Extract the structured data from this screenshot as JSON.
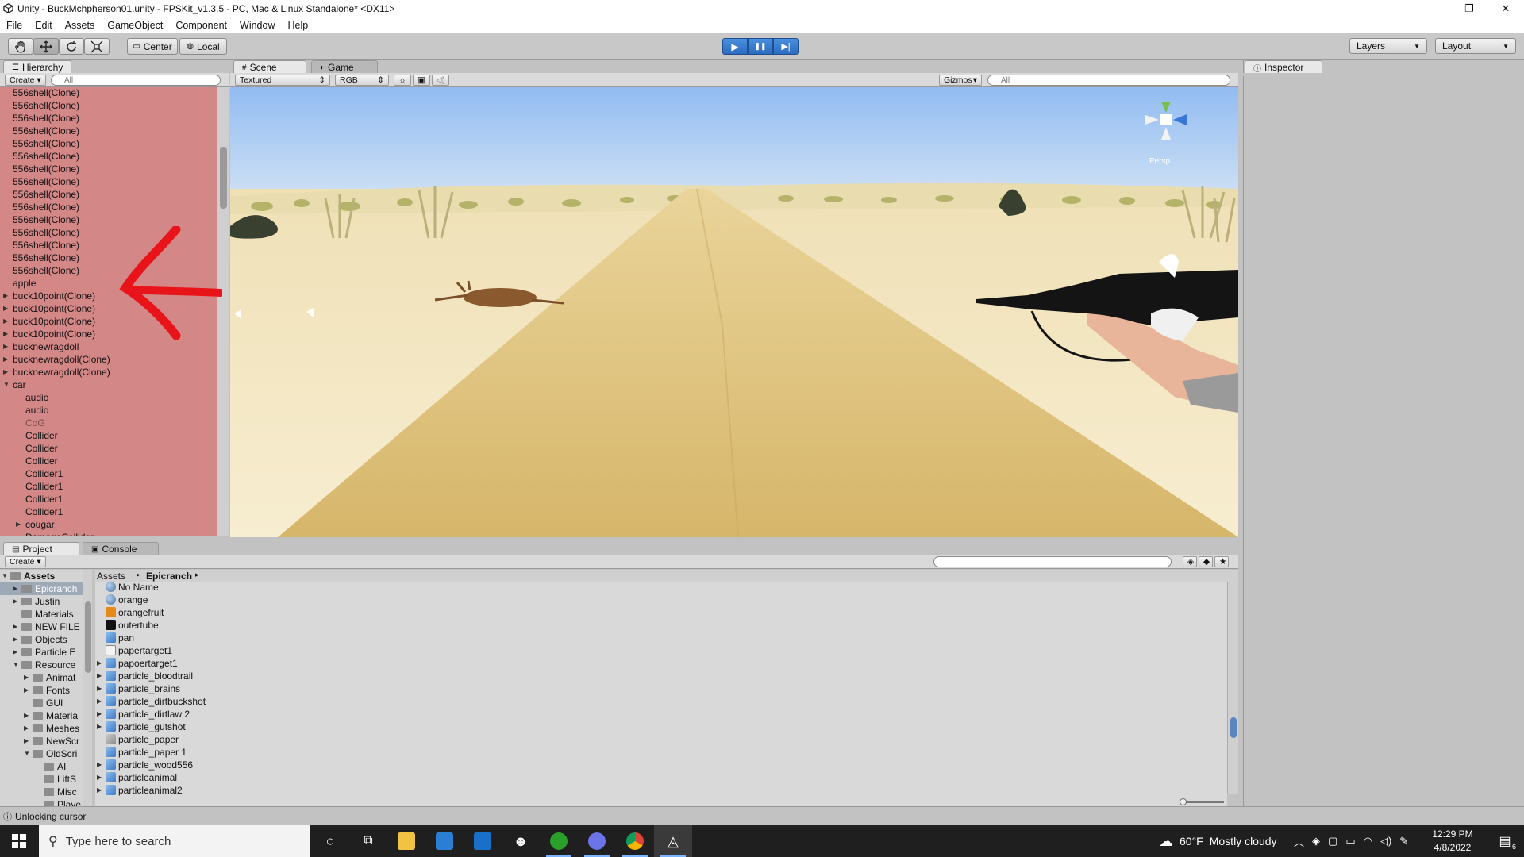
{
  "window": {
    "title": "Unity - BuckMchpherson01.unity - FPSKit_v1.3.5 - PC, Mac & Linux Standalone* <DX11>",
    "minimize": "—",
    "restore": "❐",
    "close": "✕"
  },
  "menu": [
    "File",
    "Edit",
    "Assets",
    "GameObject",
    "Component",
    "Window",
    "Help"
  ],
  "toolbar": {
    "tools": [
      "hand",
      "move",
      "rotate",
      "scale"
    ],
    "pivot_center": "Center",
    "pivot_local": "Local",
    "play": "▶",
    "pause": "❚❚",
    "step": "▶|",
    "layers": "Layers",
    "layout": "Layout"
  },
  "hierarchy": {
    "tab": "Hierarchy",
    "create": "Create",
    "search_placeholder": "All",
    "items": [
      {
        "label": "556shell(Clone)",
        "indent": 0,
        "arrow": ""
      },
      {
        "label": "556shell(Clone)",
        "indent": 0,
        "arrow": ""
      },
      {
        "label": "556shell(Clone)",
        "indent": 0,
        "arrow": ""
      },
      {
        "label": "556shell(Clone)",
        "indent": 0,
        "arrow": ""
      },
      {
        "label": "556shell(Clone)",
        "indent": 0,
        "arrow": ""
      },
      {
        "label": "556shell(Clone)",
        "indent": 0,
        "arrow": ""
      },
      {
        "label": "556shell(Clone)",
        "indent": 0,
        "arrow": ""
      },
      {
        "label": "556shell(Clone)",
        "indent": 0,
        "arrow": ""
      },
      {
        "label": "556shell(Clone)",
        "indent": 0,
        "arrow": ""
      },
      {
        "label": "556shell(Clone)",
        "indent": 0,
        "arrow": ""
      },
      {
        "label": "556shell(Clone)",
        "indent": 0,
        "arrow": ""
      },
      {
        "label": "556shell(Clone)",
        "indent": 0,
        "arrow": ""
      },
      {
        "label": "556shell(Clone)",
        "indent": 0,
        "arrow": ""
      },
      {
        "label": "556shell(Clone)",
        "indent": 0,
        "arrow": ""
      },
      {
        "label": "556shell(Clone)",
        "indent": 0,
        "arrow": ""
      },
      {
        "label": "apple",
        "indent": 0,
        "arrow": ""
      },
      {
        "label": "buck10point(Clone)",
        "indent": 0,
        "arrow": "▶"
      },
      {
        "label": "buck10point(Clone)",
        "indent": 0,
        "arrow": "▶"
      },
      {
        "label": "buck10point(Clone)",
        "indent": 0,
        "arrow": "▶"
      },
      {
        "label": "buck10point(Clone)",
        "indent": 0,
        "arrow": "▶"
      },
      {
        "label": "bucknewragdoll",
        "indent": 0,
        "arrow": "▶"
      },
      {
        "label": "bucknewragdoll(Clone)",
        "indent": 0,
        "arrow": "▶"
      },
      {
        "label": "bucknewragdoll(Clone)",
        "indent": 0,
        "arrow": "▶"
      },
      {
        "label": "car",
        "indent": 0,
        "arrow": "▼"
      },
      {
        "label": "audio",
        "indent": 1,
        "arrow": ""
      },
      {
        "label": "audio",
        "indent": 1,
        "arrow": ""
      },
      {
        "label": "CoG",
        "indent": 1,
        "arrow": "",
        "dim": true
      },
      {
        "label": "Collider",
        "indent": 1,
        "arrow": ""
      },
      {
        "label": "Collider",
        "indent": 1,
        "arrow": ""
      },
      {
        "label": "Collider",
        "indent": 1,
        "arrow": ""
      },
      {
        "label": "Collider1",
        "indent": 1,
        "arrow": ""
      },
      {
        "label": "Collider1",
        "indent": 1,
        "arrow": ""
      },
      {
        "label": "Collider1",
        "indent": 1,
        "arrow": ""
      },
      {
        "label": "Collider1",
        "indent": 1,
        "arrow": ""
      },
      {
        "label": "cougar",
        "indent": 1,
        "arrow": "▶"
      },
      {
        "label": "DamageCollider",
        "indent": 1,
        "arrow": ""
      }
    ]
  },
  "scene": {
    "tab_scene": "Scene",
    "tab_game": "Game",
    "render_mode": "Textured",
    "color_mode": "RGB",
    "gizmos": "Gizmos",
    "search_placeholder": "All",
    "persp": "Persp"
  },
  "inspector": {
    "tab": "Inspector"
  },
  "project": {
    "tab_project": "Project",
    "tab_console": "Console",
    "create": "Create",
    "breadcrumb_root": "Assets",
    "breadcrumb_current": "Epicranch",
    "tree": [
      {
        "label": "Assets",
        "indent": 0,
        "arrow": "▼",
        "bold": true
      },
      {
        "label": "Epicranch",
        "indent": 1,
        "arrow": "▶",
        "selected": true
      },
      {
        "label": "Justin",
        "indent": 1,
        "arrow": "▶"
      },
      {
        "label": "Materials",
        "indent": 1,
        "arrow": ""
      },
      {
        "label": "NEW FILE",
        "indent": 1,
        "arrow": "▶"
      },
      {
        "label": "Objects",
        "indent": 1,
        "arrow": "▶"
      },
      {
        "label": "Particle E",
        "indent": 1,
        "arrow": "▶"
      },
      {
        "label": "Resource",
        "indent": 1,
        "arrow": "▼"
      },
      {
        "label": "Animat",
        "indent": 2,
        "arrow": "▶"
      },
      {
        "label": "Fonts",
        "indent": 2,
        "arrow": "▶"
      },
      {
        "label": "GUI",
        "indent": 2,
        "arrow": ""
      },
      {
        "label": "Materia",
        "indent": 2,
        "arrow": "▶"
      },
      {
        "label": "Meshes",
        "indent": 2,
        "arrow": "▶"
      },
      {
        "label": "NewScr",
        "indent": 2,
        "arrow": "▶"
      },
      {
        "label": "OldScri",
        "indent": 2,
        "arrow": "▼"
      },
      {
        "label": "AI",
        "indent": 3,
        "arrow": ""
      },
      {
        "label": "LiftS",
        "indent": 3,
        "arrow": ""
      },
      {
        "label": "Misc",
        "indent": 3,
        "arrow": ""
      },
      {
        "label": "Playe",
        "indent": 3,
        "arrow": ""
      }
    ],
    "assets": [
      {
        "label": "No Name",
        "icon": "sphere",
        "arrow": ""
      },
      {
        "label": "orange",
        "icon": "sphere",
        "arrow": ""
      },
      {
        "label": "orangefruit",
        "icon": "orange-texture",
        "arrow": ""
      },
      {
        "label": "outertube",
        "icon": "black-texture",
        "arrow": ""
      },
      {
        "label": "pan",
        "icon": "prefab",
        "arrow": ""
      },
      {
        "label": "papertarget1",
        "icon": "doc",
        "arrow": ""
      },
      {
        "label": "papoertarget1",
        "icon": "prefab",
        "arrow": "▶"
      },
      {
        "label": "particle_bloodtrail",
        "icon": "prefab",
        "arrow": "▶"
      },
      {
        "label": "particle_brains",
        "icon": "prefab",
        "arrow": "▶"
      },
      {
        "label": "particle_dirtbuckshot",
        "icon": "prefab",
        "arrow": "▶"
      },
      {
        "label": "particle_dirtlaw 2",
        "icon": "prefab",
        "arrow": "▶"
      },
      {
        "label": "particle_gutshot",
        "icon": "prefab",
        "arrow": "▶"
      },
      {
        "label": "particle_paper",
        "icon": "prefab-gray",
        "arrow": ""
      },
      {
        "label": "particle_paper 1",
        "icon": "prefab",
        "arrow": ""
      },
      {
        "label": "particle_wood556",
        "icon": "prefab",
        "arrow": "▶"
      },
      {
        "label": "particleanimal",
        "icon": "prefab",
        "arrow": "▶"
      },
      {
        "label": "particleanimal2",
        "icon": "prefab",
        "arrow": "▶"
      }
    ]
  },
  "status": {
    "text": "Unlocking cursor"
  },
  "taskbar": {
    "search_placeholder": "Type here to search",
    "weather_temp": "60°F",
    "weather_desc": "Mostly cloudy",
    "time": "12:29 PM",
    "date": "4/8/2022",
    "notification_count": "6"
  },
  "colors": {
    "hierarchy_highlight": "#d48787",
    "play_blue": "#2c6cc0",
    "annotation_arrow": "#e8141a",
    "sky": "#a6c8f0",
    "sand": "#f2e0b0"
  }
}
